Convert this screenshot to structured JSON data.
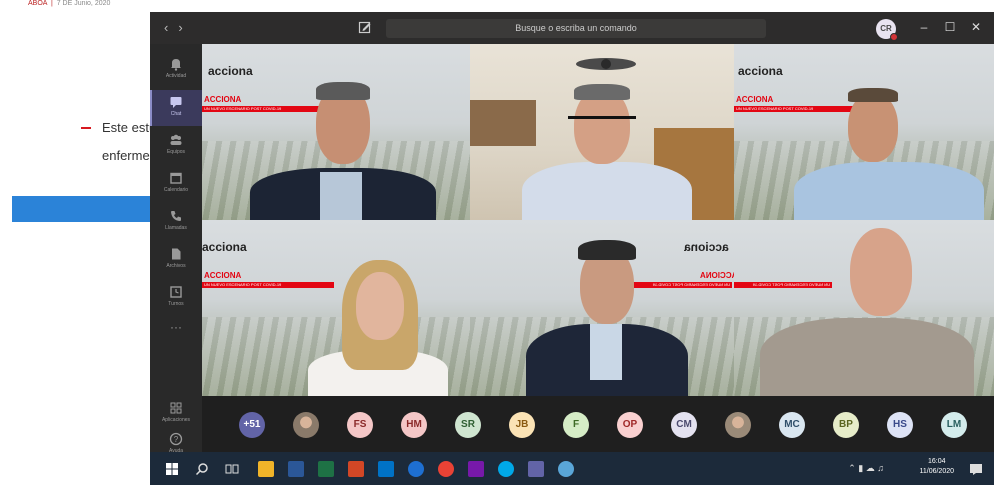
{
  "background_page": {
    "top_text_1": "ABOA",
    "top_text_2": "7 DE Junio, 2020",
    "line1": "Este estu",
    "line2": "enfermec"
  },
  "titlebar": {
    "search_placeholder": "Busque o escriba un comando",
    "me_initials": "CR",
    "nav_back": "‹",
    "nav_forward": "›",
    "minimize": "–",
    "maximize": "☐",
    "close": "✕"
  },
  "rail": {
    "items": [
      {
        "label": "Actividad",
        "icon": "bell-icon"
      },
      {
        "label": "Chat",
        "icon": "chat-icon"
      },
      {
        "label": "Equipos",
        "icon": "teams-icon"
      },
      {
        "label": "Calendario",
        "icon": "calendar-icon"
      },
      {
        "label": "Llamadas",
        "icon": "phone-icon"
      },
      {
        "label": "Archivos",
        "icon": "files-icon"
      },
      {
        "label": "Turnos",
        "icon": "clock-icon"
      },
      {
        "label": "···",
        "icon": "more-icon"
      },
      {
        "label": "Aplicaciones",
        "icon": "apps-icon"
      },
      {
        "label": "Ayuda",
        "icon": "help-icon"
      }
    ]
  },
  "tiles": {
    "brand": "acciona",
    "brand_mirrored": "acciona",
    "red_label": "ACCIONA",
    "red_label_mirrored": "ACCIONA",
    "red_bar": "UN NUEVO ESCENARIO POST COVID-19"
  },
  "participants": [
    {
      "initials": "+51",
      "color": "#6264a7",
      "text_color": "#ffffff"
    },
    {
      "initials": "",
      "color": "#8a7a6a",
      "text_color": "#ffffff",
      "photo": true
    },
    {
      "initials": "FS",
      "color": "#f4c7c7",
      "text_color": "#8a2a2a"
    },
    {
      "initials": "HM",
      "color": "#f4c7c7",
      "text_color": "#8a2a2a"
    },
    {
      "initials": "SR",
      "color": "#cfe5d0",
      "text_color": "#2f5f32"
    },
    {
      "initials": "JB",
      "color": "#fbe3b5",
      "text_color": "#8a5a10"
    },
    {
      "initials": "F",
      "color": "#d5ecc6",
      "text_color": "#3d6a25"
    },
    {
      "initials": "OP",
      "color": "#f9d0d0",
      "text_color": "#a02828"
    },
    {
      "initials": "CM",
      "color": "#e4e2f0",
      "text_color": "#4b4a6e"
    },
    {
      "initials": "",
      "color": "#9a8a78",
      "text_color": "#ffffff",
      "photo": true
    },
    {
      "initials": "MC",
      "color": "#d9e6f0",
      "text_color": "#2f4f6a"
    },
    {
      "initials": "BP",
      "color": "#e6ecc9",
      "text_color": "#5a6420"
    },
    {
      "initials": "HS",
      "color": "#dde3f5",
      "text_color": "#3a4a8a"
    },
    {
      "initials": "LM",
      "color": "#d4ecec",
      "text_color": "#2a6060"
    }
  ],
  "taskbar": {
    "time": "16:04",
    "date": "11/06/2020"
  }
}
